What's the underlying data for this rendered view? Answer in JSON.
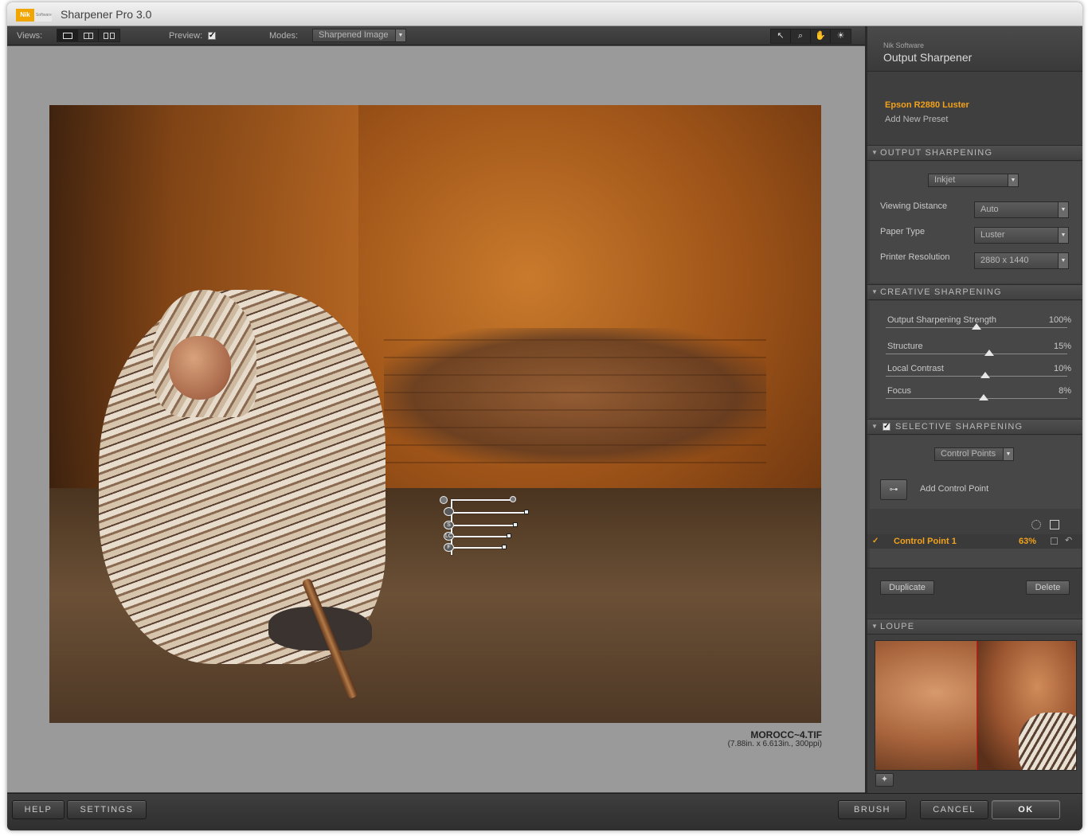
{
  "window": {
    "logo_a": "Nik",
    "logo_b": "Software",
    "title": "Sharpener Pro 3.0"
  },
  "toolbar": {
    "views_label": "Views:",
    "preview_label": "Preview:",
    "preview_checked": true,
    "modes_label": "Modes:",
    "mode_value": "Sharpened Image",
    "tools": [
      "arrow-icon",
      "zoom-icon",
      "hand-icon",
      "light-icon"
    ]
  },
  "image": {
    "file_name": "MOROCC~4.TIF",
    "file_meta": "(7.88in. x 6.613in., 300ppi)"
  },
  "control_point_tabs": [
    "",
    "S",
    "LC",
    "F"
  ],
  "panel": {
    "brand": "Nik Software",
    "title": "Output Sharpener",
    "preset_name": "Epson R2880 Luster",
    "add_preset": "Add New Preset",
    "output_section": {
      "title": "OUTPUT SHARPENING",
      "type_value": "Inkjet",
      "fields": [
        {
          "label": "Viewing Distance",
          "value": "Auto"
        },
        {
          "label": "Paper Type",
          "value": "Luster"
        },
        {
          "label": "Printer Resolution",
          "value": "2880 x 1440"
        }
      ]
    },
    "creative_section": {
      "title": "CREATIVE SHARPENING",
      "sliders": [
        {
          "label": "Output Sharpening Strength",
          "value": "100%",
          "level": 0.5
        },
        {
          "label": "Structure",
          "value": "15%",
          "level": 0.57
        },
        {
          "label": "Local Contrast",
          "value": "10%",
          "level": 0.55
        },
        {
          "label": "Focus",
          "value": "8%",
          "level": 0.54
        }
      ]
    },
    "selective_section": {
      "title": "SELECTIVE SHARPENING",
      "enabled": true,
      "method": "Control Points",
      "add_label": "Add Control Point",
      "control_points": [
        {
          "name": "Control Point 1",
          "opacity": "63%",
          "checked": true
        }
      ],
      "duplicate": "Duplicate",
      "delete": "Delete"
    },
    "loupe_section": {
      "title": "LOUPE"
    }
  },
  "bottom": {
    "help": "HELP",
    "settings": "SETTINGS",
    "brush": "BRUSH",
    "cancel": "CANCEL",
    "ok": "OK"
  },
  "colors": {
    "accent": "#f2a21b",
    "panel_bg": "#3f3f3f",
    "canvas_bg": "#9a9a9a",
    "loupe_divider": "#e01010"
  }
}
